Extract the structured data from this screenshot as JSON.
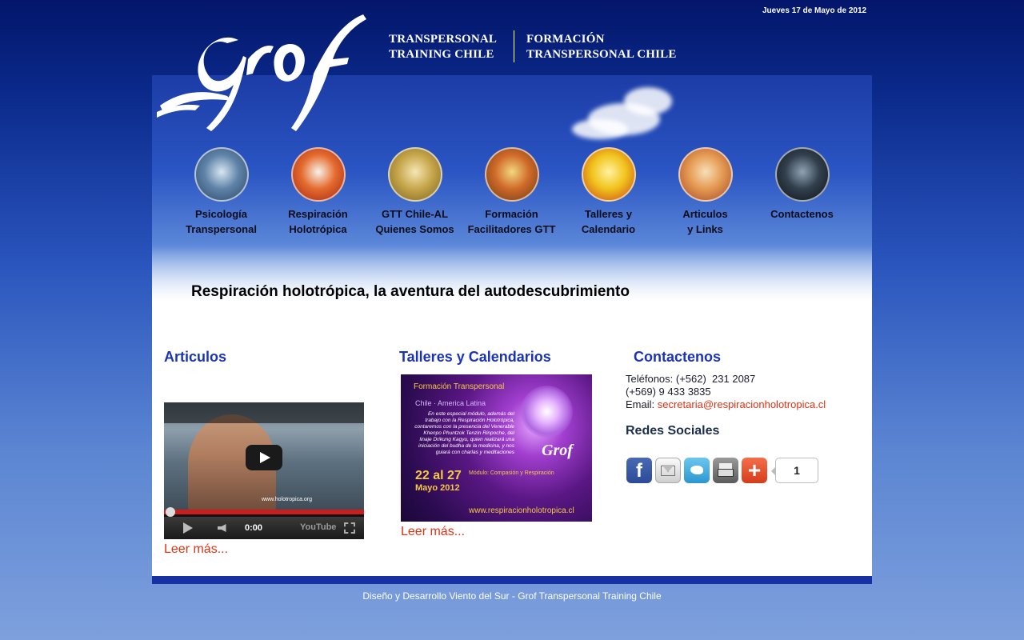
{
  "header": {
    "date": "Jueves 17 de Mayo de 2012",
    "logo_text": "Grof",
    "title_left": [
      "TRANSPERSONAL",
      "TRAINING CHILE"
    ],
    "title_right": [
      "FORMACIÓN",
      "TRANSPERSONAL CHILE"
    ]
  },
  "nav": {
    "items": [
      {
        "line1": "Psicología",
        "line2": "Transpersonal",
        "icon": "phoenix-blue-icon",
        "colors": [
          "#d9e6f2",
          "#5f83a8",
          "#2c4766"
        ]
      },
      {
        "line1": "Respiración",
        "line2": "Holotrópica",
        "icon": "phoenix-red-icon",
        "colors": [
          "#f7f2e8",
          "#e56b2f",
          "#9f2413"
        ]
      },
      {
        "line1": "GTT Chile-AL",
        "line2": "Quienes Somos",
        "icon": "golden-figure-icon",
        "colors": [
          "#f5e6b3",
          "#c7a74c",
          "#7a6220"
        ]
      },
      {
        "line1": "Formación",
        "line2": "Facilitadores GTT",
        "icon": "firebird-icon",
        "colors": [
          "#f2d77f",
          "#d06a2a",
          "#6a3b12"
        ]
      },
      {
        "line1": "Talleres y",
        "line2": "Calendario",
        "icon": "tree-of-life-icon",
        "colors": [
          "#fff3a0",
          "#f1c31c",
          "#c9401a"
        ]
      },
      {
        "line1": "Articulos",
        "line2": "y Links",
        "icon": "sea-horse-icon",
        "colors": [
          "#f7dfb8",
          "#e59a52",
          "#a2462a"
        ]
      },
      {
        "line1": "Contactenos",
        "line2": "",
        "icon": "jellyfish-icon",
        "colors": [
          "#8fa3b4",
          "#32404d",
          "#0c1118"
        ]
      }
    ]
  },
  "banner": {
    "heading": "Respiración holotrópica, la aventura del autodescubrimiento"
  },
  "articulos": {
    "title": "Articulos",
    "video": {
      "watermark": "www.holotropica.org",
      "time": "0:00",
      "brand": "YouTube"
    },
    "read_more": "Leer más..."
  },
  "talleres": {
    "title": "Talleres y Calendarios",
    "poster": {
      "title": "Formación Transpersonal",
      "subtitle": "Chile · America Latina",
      "text": "En este especial módulo, además del trabajo con la Respiración Holotrópica, contaremos con la presencia del Venerable Khenpo Phuntzok Tenzin Rinpoche, del linaje Drikung Kagyu, quien realizará una iniciación del budha de la medicina, y nos guiará con charlas y meditaciones",
      "logo": "Grof",
      "dates": "22 al 27",
      "month": "Mayo 2012",
      "module": "Módulo: Compasión y Respiración",
      "url": "www.respiracionholotropica.cl"
    },
    "read_more": "Leer más..."
  },
  "contacto": {
    "title": "Contactenos",
    "phone_line": "Teléfonos: (+562)  231 2087",
    "phone_line2": "(+569) 9 433 3835",
    "email_label": "Email: ",
    "email": "secretaria@respiracionholotropica.cl",
    "social_title": "Redes Sociales",
    "share_count": "1",
    "share_buttons": [
      "facebook-icon",
      "email-icon",
      "twitter-icon",
      "print-icon",
      "addthis-plus-icon"
    ]
  },
  "footer": {
    "text": "Diseño y Desarrollo Viento del Sur - Grof Transpersonal Training Chile"
  }
}
